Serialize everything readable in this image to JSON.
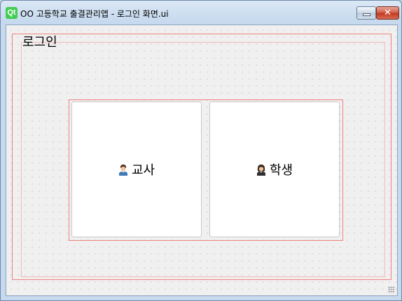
{
  "window": {
    "title": "OO 고등학교 출결관리앱 - 로그인 화면.ui",
    "app_icon_text": "Qt",
    "close_glyph": "✕"
  },
  "login_group": {
    "title": "로그인"
  },
  "roles": {
    "teacher": {
      "label": "교사",
      "icon": "teacher-person-icon"
    },
    "student": {
      "label": "학생",
      "icon": "student-person-icon"
    }
  },
  "colors": {
    "qt_green": "#41cd52",
    "layout_outline": "#f08080",
    "close_red": "#c2371e"
  }
}
